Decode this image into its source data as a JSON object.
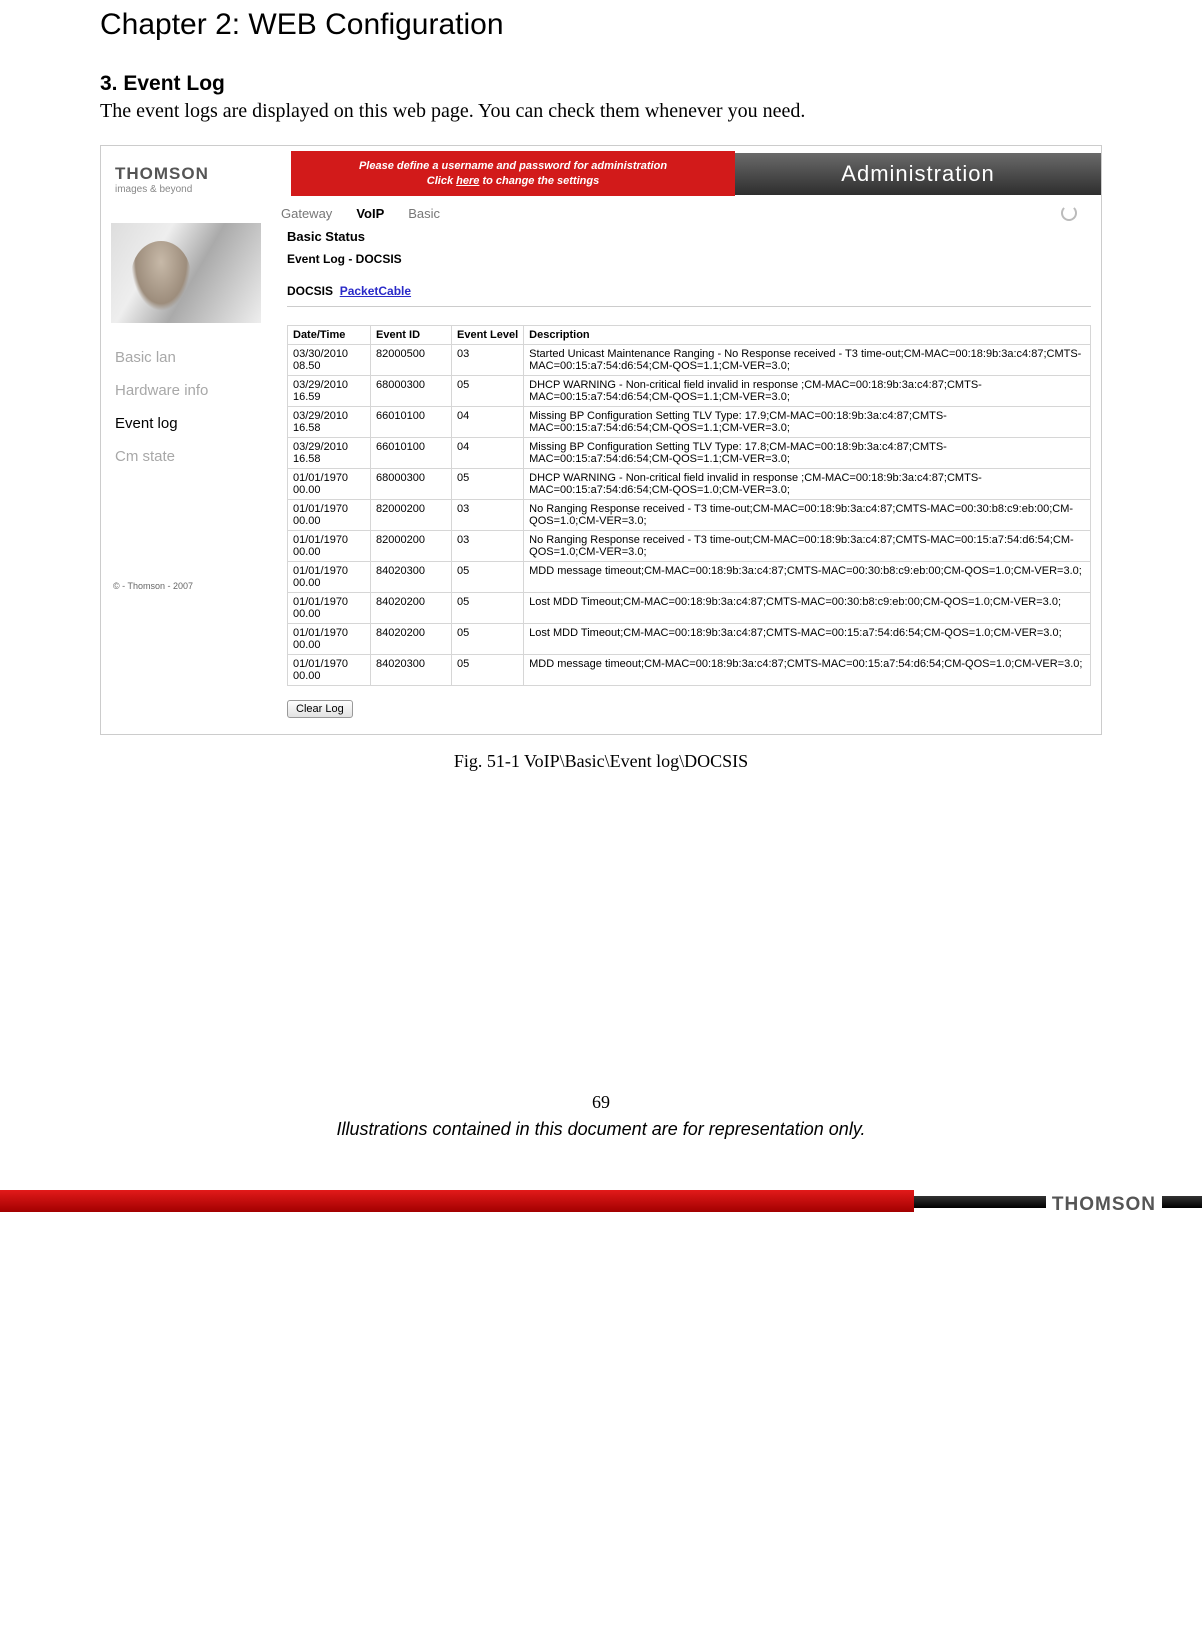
{
  "chapter_title": "Chapter 2: WEB Configuration",
  "section_heading": "3. Event Log",
  "section_para": "The event logs are displayed on this web page. You can check them whenever you need.",
  "figure_caption": "Fig. 51-1 VoIP\\Basic\\Event log\\DOCSIS",
  "page_number": "69",
  "footer_note": "Illustrations contained in this document are for representation only.",
  "brand": "THOMSON",
  "brand_tag": "images & beyond",
  "screenshot": {
    "warn_line1": "Please define a username and password for administration",
    "warn_line2_pre": "Click ",
    "warn_line2_link": "here",
    "warn_line2_post": " to change the settings",
    "title_right": "Administration",
    "tabs": {
      "gateway": "Gateway",
      "voip": "VoIP",
      "basic": "Basic"
    },
    "side": {
      "items": [
        "Basic lan",
        "Hardware info",
        "Event log",
        "Cm state"
      ],
      "active_index": 2,
      "copyright": "© - Thomson - 2007"
    },
    "heading": "Basic Status",
    "subheading": "Event Log - DOCSIS",
    "proto_label": "DOCSIS",
    "proto_link": "PacketCable",
    "columns": [
      "Date/Time",
      "Event ID",
      "Event Level",
      "Description"
    ],
    "rows": [
      {
        "dt": "03/30/2010 08.50",
        "id": "82000500",
        "lvl": "03",
        "desc": "Started Unicast Maintenance Ranging - No Response received - T3 time-out;CM-MAC=00:18:9b:3a:c4:87;CMTS-MAC=00:15:a7:54:d6:54;CM-QOS=1.1;CM-VER=3.0;"
      },
      {
        "dt": "03/29/2010 16.59",
        "id": "68000300",
        "lvl": "05",
        "desc": "DHCP WARNING - Non-critical field invalid in response ;CM-MAC=00:18:9b:3a:c4:87;CMTS-MAC=00:15:a7:54:d6:54;CM-QOS=1.1;CM-VER=3.0;"
      },
      {
        "dt": "03/29/2010 16.58",
        "id": "66010100",
        "lvl": "04",
        "desc": "Missing BP Configuration Setting TLV Type: 17.9;CM-MAC=00:18:9b:3a:c4:87;CMTS-MAC=00:15:a7:54:d6:54;CM-QOS=1.1;CM-VER=3.0;"
      },
      {
        "dt": "03/29/2010 16.58",
        "id": "66010100",
        "lvl": "04",
        "desc": "Missing BP Configuration Setting TLV Type: 17.8;CM-MAC=00:18:9b:3a:c4:87;CMTS-MAC=00:15:a7:54:d6:54;CM-QOS=1.1;CM-VER=3.0;"
      },
      {
        "dt": "01/01/1970 00.00",
        "id": "68000300",
        "lvl": "05",
        "desc": "DHCP WARNING - Non-critical field invalid in response ;CM-MAC=00:18:9b:3a:c4:87;CMTS-MAC=00:15:a7:54:d6:54;CM-QOS=1.0;CM-VER=3.0;"
      },
      {
        "dt": "01/01/1970 00.00",
        "id": "82000200",
        "lvl": "03",
        "desc": "No Ranging Response received - T3 time-out;CM-MAC=00:18:9b:3a:c4:87;CMTS-MAC=00:30:b8:c9:eb:00;CM-QOS=1.0;CM-VER=3.0;"
      },
      {
        "dt": "01/01/1970 00.00",
        "id": "82000200",
        "lvl": "03",
        "desc": "No Ranging Response received - T3 time-out;CM-MAC=00:18:9b:3a:c4:87;CMTS-MAC=00:15:a7:54:d6:54;CM-QOS=1.0;CM-VER=3.0;"
      },
      {
        "dt": "01/01/1970 00.00",
        "id": "84020300",
        "lvl": "05",
        "desc": "MDD message timeout;CM-MAC=00:18:9b:3a:c4:87;CMTS-MAC=00:30:b8:c9:eb:00;CM-QOS=1.0;CM-VER=3.0;"
      },
      {
        "dt": "01/01/1970 00.00",
        "id": "84020200",
        "lvl": "05",
        "desc": "Lost MDD Timeout;CM-MAC=00:18:9b:3a:c4:87;CMTS-MAC=00:30:b8:c9:eb:00;CM-QOS=1.0;CM-VER=3.0;"
      },
      {
        "dt": "01/01/1970 00.00",
        "id": "84020200",
        "lvl": "05",
        "desc": "Lost MDD Timeout;CM-MAC=00:18:9b:3a:c4:87;CMTS-MAC=00:15:a7:54:d6:54;CM-QOS=1.0;CM-VER=3.0;"
      },
      {
        "dt": "01/01/1970 00.00",
        "id": "84020300",
        "lvl": "05",
        "desc": "MDD message timeout;CM-MAC=00:18:9b:3a:c4:87;CMTS-MAC=00:15:a7:54:d6:54;CM-QOS=1.0;CM-VER=3.0;"
      }
    ],
    "clear_btn": "Clear Log"
  }
}
